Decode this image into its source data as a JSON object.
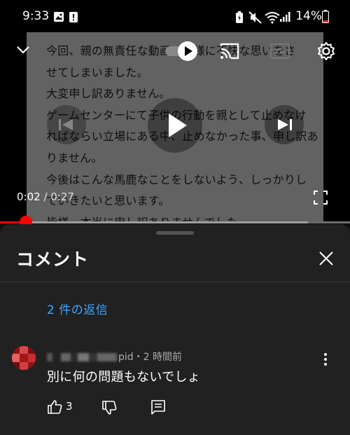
{
  "status_bar": {
    "time": "9:33",
    "battery": "14%",
    "icons": [
      "gallery-icon",
      "notification-icon",
      "battery-saver-icon",
      "mute-icon",
      "wifi-icon",
      "signal-icon",
      "battery-icon"
    ]
  },
  "video": {
    "frame_lines": [
      "今回、親の無責任な動画で皆様に不快な思いをさ",
      "せてしまいました。",
      "大変申し訳ありません。",
      "ゲームセンターにて子供の行動を親として止めなけ",
      "ればならい立場にある中、止めなかった事、申し訳あ",
      "りません。",
      "今後はこんな馬鹿なことをしないよう、しっかりし",
      "ていきたいと思います。",
      "皆様、本当に申し訳ありませんでした。"
    ],
    "current_time": "0:02",
    "separator": " / ",
    "duration": "0:27",
    "progress": 0.074,
    "buffered": 0.88
  },
  "comments": {
    "title": "コメント",
    "replies_label": "2 件の返信",
    "comment": {
      "author_suffix": "pid・2 時間前",
      "text": "別に何の問題もないでしょ",
      "like_count": "3"
    }
  },
  "colors": {
    "accent_red": "#ff0000",
    "link_blue": "#3ea6ff",
    "sheet_bg": "#212121"
  }
}
